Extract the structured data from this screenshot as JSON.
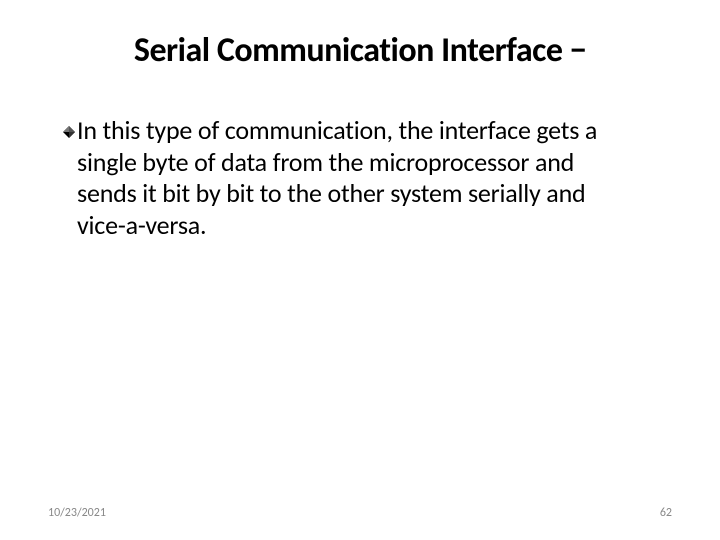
{
  "title": "Serial Communication Interface −",
  "body": "In this type of communication, the interface gets a single byte of data from the microprocessor and sends it bit by bit to the other system serially and vice-a-versa.",
  "footer": {
    "date": "10/23/2021",
    "page": "62"
  }
}
